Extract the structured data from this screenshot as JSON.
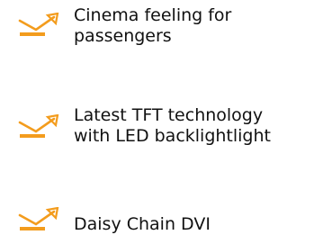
{
  "colors": {
    "icon_accent": "#f39c1d",
    "text": "#111111"
  },
  "features": [
    {
      "icon": "projection-arrow-icon",
      "lines": [
        "Cinema feeling for",
        "passengers"
      ]
    },
    {
      "icon": "projection-arrow-icon",
      "lines": [
        "Latest TFT technology",
        "with LED backlightlight"
      ]
    },
    {
      "icon": "projection-arrow-icon",
      "lines": [
        "Daisy Chain DVI"
      ]
    }
  ]
}
